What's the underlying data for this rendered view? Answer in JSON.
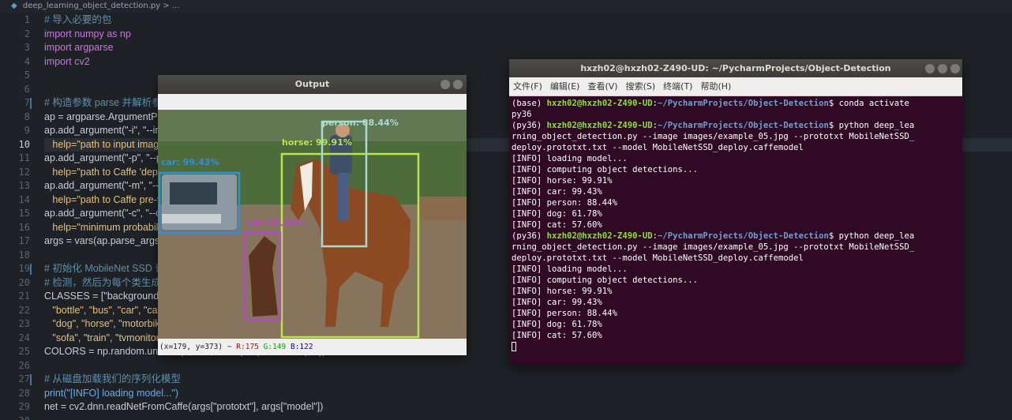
{
  "editor": {
    "file": "deep_learning_object_detection.py",
    "crumb_tail": "> ...",
    "current_line": 10,
    "modified_lines": [
      7,
      19,
      27
    ],
    "lines": [
      {
        "n": 1,
        "t": "# 导入必要的包",
        "k": "cm"
      },
      {
        "n": 2,
        "t": "import numpy as np",
        "k": "kw"
      },
      {
        "n": 3,
        "t": "import argparse",
        "k": "kw"
      },
      {
        "n": 4,
        "t": "import cv2",
        "k": "kw"
      },
      {
        "n": 5,
        "t": "",
        "k": "nm"
      },
      {
        "n": 6,
        "t": "",
        "k": "nm"
      },
      {
        "n": 7,
        "t": "# 构造参数 parse 并解析参数",
        "k": "cm"
      },
      {
        "n": 8,
        "t": "ap = argparse.ArgumentParser()",
        "k": "nm"
      },
      {
        "n": 9,
        "t": "ap.add_argument(\"-i\", \"--image\", required=True,",
        "k": "nm"
      },
      {
        "n": 10,
        "t": "   help=\"path to input image\")",
        "k": "st"
      },
      {
        "n": 11,
        "t": "ap.add_argument(\"-p\", \"--prototxt\", required=True,",
        "k": "nm"
      },
      {
        "n": 12,
        "t": "   help=\"path to Caffe 'deploy' prototxt file\")",
        "k": "st"
      },
      {
        "n": 13,
        "t": "ap.add_argument(\"-m\", \"--model\", required=True,",
        "k": "nm"
      },
      {
        "n": 14,
        "t": "   help=\"path to Caffe pre-trained model\")",
        "k": "st"
      },
      {
        "n": 15,
        "t": "ap.add_argument(\"-c\", \"--confidence\", type=float, default=0.2,",
        "k": "nm"
      },
      {
        "n": 16,
        "t": "   help=\"minimum probability to filter weak detections\")",
        "k": "st"
      },
      {
        "n": 17,
        "t": "args = vars(ap.parse_args())",
        "k": "nm"
      },
      {
        "n": 18,
        "t": "",
        "k": "nm"
      },
      {
        "n": 19,
        "t": "# 初始化 MobileNet SSD 训练的类标签列表",
        "k": "cm"
      },
      {
        "n": 20,
        "t": "# 检测，然后为每个类生成一组边界框颜色",
        "k": "cm"
      },
      {
        "n": 21,
        "t": "CLASSES = [\"background\", \"aeroplane\", \"bicycle\", \"bird\", \"boat\",",
        "k": "nm"
      },
      {
        "n": 22,
        "t": "   \"bottle\", \"bus\", \"car\", \"cat\", \"chair\", \"cow\", \"diningtable\",",
        "k": "st"
      },
      {
        "n": 23,
        "t": "   \"dog\", \"horse\", \"motorbike\", \"person\", \"pottedplant\", \"sheep\",",
        "k": "st"
      },
      {
        "n": 24,
        "t": "   \"sofa\", \"train\", \"tvmonitor\"]",
        "k": "st"
      },
      {
        "n": 25,
        "t": "COLORS = np.random.uniform(0, 255, size=(len(CLASSES), 3))",
        "k": "nm"
      },
      {
        "n": 26,
        "t": "",
        "k": "nm"
      },
      {
        "n": 27,
        "t": "# 从磁盘加载我们的序列化模型",
        "k": "cm"
      },
      {
        "n": 28,
        "t": "print(\"[INFO] loading model...\")",
        "k": "fn"
      },
      {
        "n": 29,
        "t": "net = cv2.dnn.readNetFromCaffe(args[\"prototxt\"], args[\"model\"])",
        "k": "nm"
      },
      {
        "n": 30,
        "t": "",
        "k": "nm"
      }
    ]
  },
  "output_window": {
    "title": "Output",
    "detections": [
      {
        "label": "car: 99.43%",
        "color": "#2e8fe0"
      },
      {
        "label": "horse: 99.91%",
        "color": "#b9e44a"
      },
      {
        "label": "person: 88.44%",
        "color": "#a9dcd1"
      },
      {
        "label": "dog: 61.78%",
        "color": "#b548c9"
      },
      {
        "label": "cat: 57.60%",
        "color": "#d13aa0"
      }
    ],
    "status": {
      "coords": "(x=179, y=373)",
      "sep": "~",
      "r": "R:175",
      "g": "G:149",
      "b": "B:122"
    }
  },
  "terminal": {
    "title": "hxzh02@hxzh02-Z490-UD: ~/PycharmProjects/Object-Detection",
    "menu": [
      "文件(F)",
      "编辑(E)",
      "查看(V)",
      "搜索(S)",
      "终端(T)",
      "帮助(H)"
    ],
    "lines": [
      {
        "env": "(base) ",
        "user": "hxzh02@hxzh02-Z490-UD",
        "sep": ":",
        "path": "~/PycharmProjects/Object-Detection",
        "cmd": "$ conda activate"
      },
      {
        "text": "py36"
      },
      {
        "env": "(py36) ",
        "user": "hxzh02@hxzh02-Z490-UD",
        "sep": ":",
        "path": "~/PycharmProjects/Object-Detection",
        "cmd": "$ python deep_lea"
      },
      {
        "text": "rning_object_detection.py --image images/example_05.jpg --prototxt MobileNetSSD_"
      },
      {
        "text": "deploy.prototxt.txt --model MobileNetSSD_deploy.caffemodel"
      },
      {
        "text": "[INFO] loading model..."
      },
      {
        "text": "[INFO] computing object detections..."
      },
      {
        "text": "[INFO] horse: 99.91%"
      },
      {
        "text": "[INFO] car: 99.43%"
      },
      {
        "text": "[INFO] person: 88.44%"
      },
      {
        "text": "[INFO] dog: 61.78%"
      },
      {
        "text": "[INFO] cat: 57.60%"
      },
      {
        "env": "(py36) ",
        "user": "hxzh02@hxzh02-Z490-UD",
        "sep": ":",
        "path": "~/PycharmProjects/Object-Detection",
        "cmd": "$ python deep_lea"
      },
      {
        "text": "rning_object_detection.py --image images/example_05.jpg --prototxt MobileNetSSD_"
      },
      {
        "text": "deploy.prototxt.txt --model MobileNetSSD_deploy.caffemodel"
      },
      {
        "text": "[INFO] loading model..."
      },
      {
        "text": "[INFO] computing object detections..."
      },
      {
        "text": "[INFO] horse: 99.91%"
      },
      {
        "text": "[INFO] car: 99.43%"
      },
      {
        "text": "[INFO] person: 88.44%"
      },
      {
        "text": "[INFO] dog: 61.78%"
      },
      {
        "text": "[INFO] cat: 57.60%"
      }
    ]
  }
}
